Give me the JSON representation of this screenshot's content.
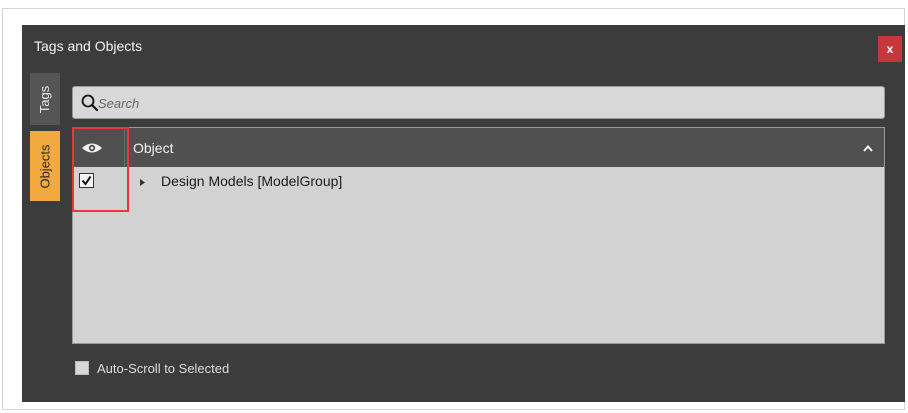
{
  "window": {
    "title": "Tags and Objects",
    "close_label": "x"
  },
  "side_tabs": [
    {
      "label": "Tags",
      "active": false
    },
    {
      "label": "Objects",
      "active": true
    }
  ],
  "search": {
    "placeholder": "Search",
    "value": ""
  },
  "grid": {
    "columns": [
      {
        "icon": "eye-icon",
        "label": ""
      },
      {
        "label": "Object"
      }
    ],
    "sort_icon": "chevron-up-icon",
    "rows": [
      {
        "visible": true,
        "expandable": true,
        "label": "Design Models [ModelGroup]"
      }
    ]
  },
  "footer": {
    "auto_scroll_label": "Auto-Scroll to Selected",
    "auto_scroll_checked": false
  },
  "colors": {
    "panel_bg": "#3c3c3c",
    "active_tab": "#f2a93f",
    "close_button": "#c6373b",
    "highlight_box": "#e8383d"
  }
}
